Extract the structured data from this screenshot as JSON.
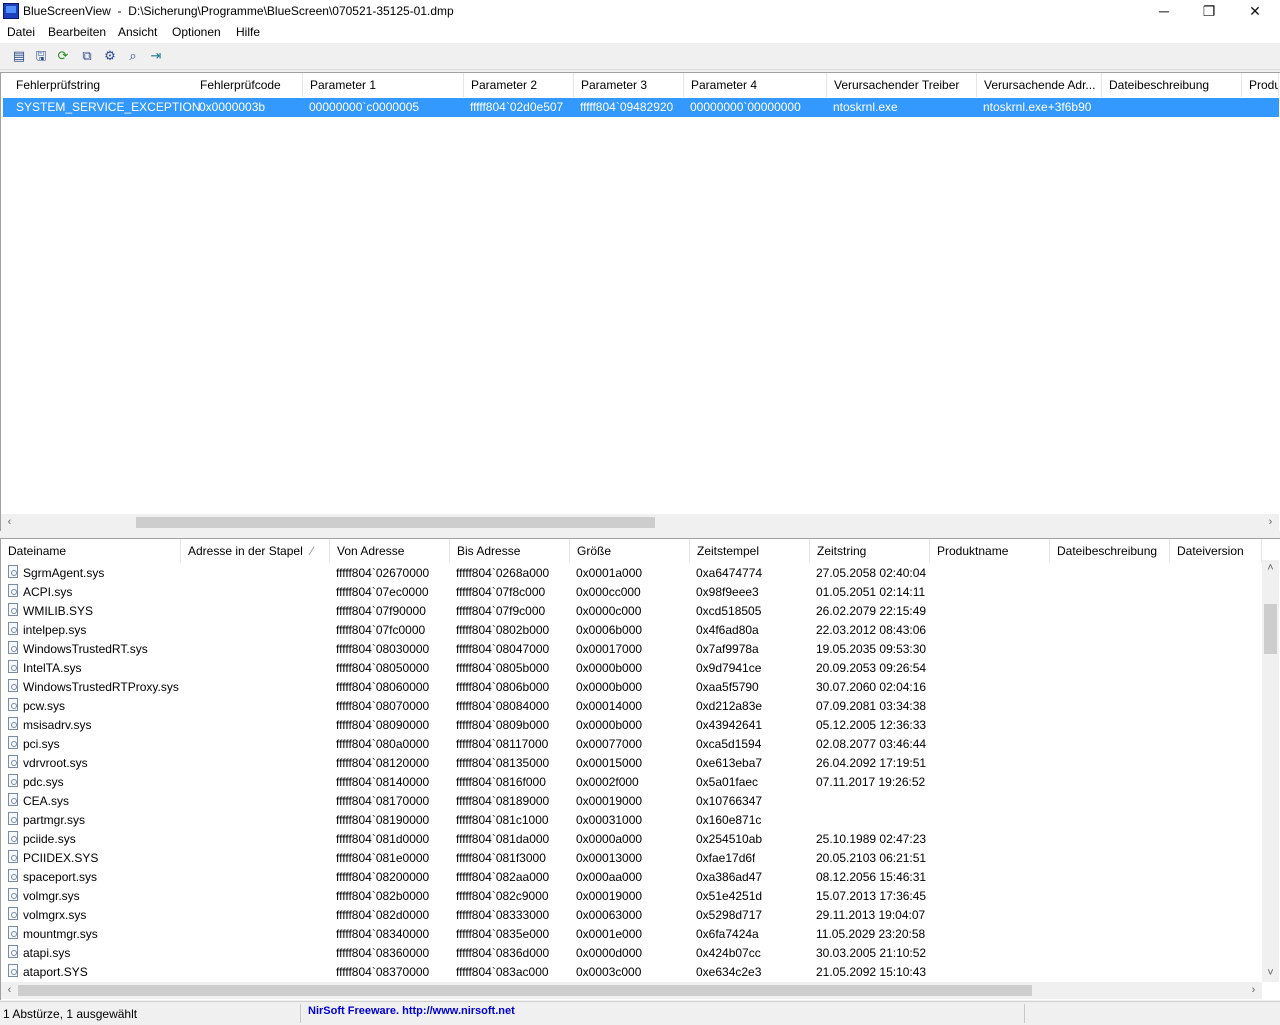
{
  "window": {
    "app_name": "BlueScreenView",
    "file_path": "D:\\Sicherung\\Programme\\BlueScreen\\070521-35125-01.dmp",
    "minimize": "─",
    "maximize": "❐",
    "close": "✕"
  },
  "menu": [
    "Datei",
    "Bearbeiten",
    "Ansicht",
    "Optionen",
    "Hilfe"
  ],
  "toolbar": [
    "properties-icon",
    "save-icon",
    "refresh-icon",
    "copy-icon",
    "options-icon",
    "find-icon",
    "exit-icon"
  ],
  "crash_list": {
    "columns": [
      "Fehlerprüfstring",
      "Fehlerprüfcode",
      "Parameter 1",
      "Parameter 2",
      "Parameter 3",
      "Parameter 4",
      "Verursachender Treiber",
      "Verursachende Adr...",
      "Dateibeschreibung",
      "Produ"
    ],
    "rows": [
      [
        "SYSTEM_SERVICE_EXCEPTION",
        "0x0000003b",
        "00000000`c0000005",
        "fffff804`02d0e507",
        "fffff804`09482920",
        "00000000`00000000",
        "ntoskrnl.exe",
        "ntoskrnl.exe+3f6b90",
        "",
        ""
      ]
    ],
    "selected_row": 0
  },
  "module_list": {
    "columns": [
      "Dateiname",
      "Adresse in der Stapel",
      "Von Adresse",
      "Bis Adresse",
      "Größe",
      "Zeitstempel",
      "Zeitstring",
      "Produktname",
      "Dateibeschreibung",
      "Dateiversion"
    ],
    "sort_indicator": "⁄",
    "rows": [
      [
        "SgrmAgent.sys",
        "",
        "fffff804`02670000",
        "fffff804`0268a000",
        "0x0001a000",
        "0xa6474774",
        "27.05.2058 02:40:04"
      ],
      [
        "ACPI.sys",
        "",
        "fffff804`07ec0000",
        "fffff804`07f8c000",
        "0x000cc000",
        "0x98f9eee3",
        "01.05.2051 02:14:11"
      ],
      [
        "WMILIB.SYS",
        "",
        "fffff804`07f90000",
        "fffff804`07f9c000",
        "0x0000c000",
        "0xcd518505",
        "26.02.2079 22:15:49"
      ],
      [
        "intelpep.sys",
        "",
        "fffff804`07fc0000",
        "fffff804`0802b000",
        "0x0006b000",
        "0x4f6ad80a",
        "22.03.2012 08:43:06"
      ],
      [
        "WindowsTrustedRT.sys",
        "",
        "fffff804`08030000",
        "fffff804`08047000",
        "0x00017000",
        "0x7af9978a",
        "19.05.2035 09:53:30"
      ],
      [
        "IntelTA.sys",
        "",
        "fffff804`08050000",
        "fffff804`0805b000",
        "0x0000b000",
        "0x9d7941ce",
        "20.09.2053 09:26:54"
      ],
      [
        "WindowsTrustedRTProxy.sys",
        "",
        "fffff804`08060000",
        "fffff804`0806b000",
        "0x0000b000",
        "0xaa5f5790",
        "30.07.2060 02:04:16"
      ],
      [
        "pcw.sys",
        "",
        "fffff804`08070000",
        "fffff804`08084000",
        "0x00014000",
        "0xd212a83e",
        "07.09.2081 03:34:38"
      ],
      [
        "msisadrv.sys",
        "",
        "fffff804`08090000",
        "fffff804`0809b000",
        "0x0000b000",
        "0x43942641",
        "05.12.2005 12:36:33"
      ],
      [
        "pci.sys",
        "",
        "fffff804`080a0000",
        "fffff804`08117000",
        "0x00077000",
        "0xca5d1594",
        "02.08.2077 03:46:44"
      ],
      [
        "vdrvroot.sys",
        "",
        "fffff804`08120000",
        "fffff804`08135000",
        "0x00015000",
        "0xe613eba7",
        "26.04.2092 17:19:51"
      ],
      [
        "pdc.sys",
        "",
        "fffff804`08140000",
        "fffff804`0816f000",
        "0x0002f000",
        "0x5a01faec",
        "07.11.2017 19:26:52"
      ],
      [
        "CEA.sys",
        "",
        "fffff804`08170000",
        "fffff804`08189000",
        "0x00019000",
        "0x10766347",
        ""
      ],
      [
        "partmgr.sys",
        "",
        "fffff804`08190000",
        "fffff804`081c1000",
        "0x00031000",
        "0x160e871c",
        ""
      ],
      [
        "pciide.sys",
        "",
        "fffff804`081d0000",
        "fffff804`081da000",
        "0x0000a000",
        "0x254510ab",
        "25.10.1989 02:47:23"
      ],
      [
        "PCIIDEX.SYS",
        "",
        "fffff804`081e0000",
        "fffff804`081f3000",
        "0x00013000",
        "0xfae17d6f",
        "20.05.2103 06:21:51"
      ],
      [
        "spaceport.sys",
        "",
        "fffff804`08200000",
        "fffff804`082aa000",
        "0x000aa000",
        "0xa386ad47",
        "08.12.2056 15:46:31"
      ],
      [
        "volmgr.sys",
        "",
        "fffff804`082b0000",
        "fffff804`082c9000",
        "0x00019000",
        "0x51e4251d",
        "15.07.2013 17:36:45"
      ],
      [
        "volmgrx.sys",
        "",
        "fffff804`082d0000",
        "fffff804`08333000",
        "0x00063000",
        "0x5298d717",
        "29.11.2013 19:04:07"
      ],
      [
        "mountmgr.sys",
        "",
        "fffff804`08340000",
        "fffff804`0835e000",
        "0x0001e000",
        "0x6fa7424a",
        "11.05.2029 23:20:58"
      ],
      [
        "atapi.sys",
        "",
        "fffff804`08360000",
        "fffff804`0836d000",
        "0x0000d000",
        "0x424b07cc",
        "30.03.2005 21:10:52"
      ],
      [
        "ataport.SYS",
        "",
        "fffff804`08370000",
        "fffff804`083ac000",
        "0x0003c000",
        "0xe634c2e3",
        "21.05.2092 15:10:43"
      ]
    ]
  },
  "scroll": {
    "left": "‹",
    "right": "›",
    "up": "˄",
    "down": "˅"
  },
  "status": {
    "count": "1 Abstürze, 1 ausgewählt",
    "freeware": "NirSoft Freeware.  http://www.nirsoft.net",
    "link_color": "#0000cc"
  }
}
